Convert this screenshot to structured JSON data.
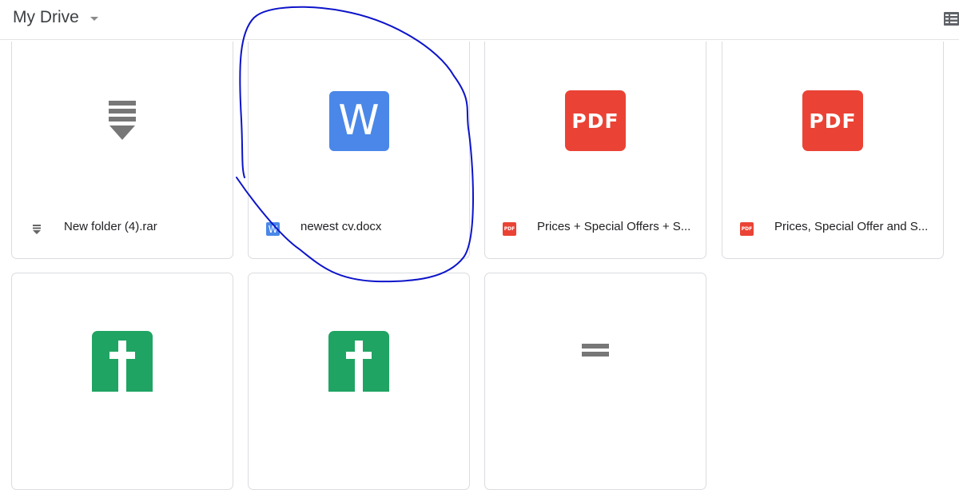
{
  "header": {
    "title": "My Drive"
  },
  "colors": {
    "word": "#4a87e8",
    "pdf": "#ea4335",
    "sheet": "#20a463",
    "annotation": "#0d14c9"
  },
  "files": [
    {
      "name": "New folder (4).rar",
      "type": "archive",
      "icon": "archive-icon"
    },
    {
      "name": "newest cv.docx",
      "type": "word",
      "icon": "word-doc-icon",
      "big_letter": "W",
      "small_letter": "W"
    },
    {
      "name": "Prices + Special Offers + S...",
      "type": "pdf",
      "icon": "pdf-icon",
      "big_label": "PDF",
      "small_label": "PDF"
    },
    {
      "name": "Prices, Special Offer and S...",
      "type": "pdf",
      "icon": "pdf-icon",
      "big_label": "PDF",
      "small_label": "PDF"
    },
    {
      "type": "sheet",
      "icon": "spreadsheet-icon"
    },
    {
      "type": "sheet",
      "icon": "spreadsheet-icon"
    },
    {
      "type": "archive",
      "icon": "archive-icon"
    }
  ]
}
